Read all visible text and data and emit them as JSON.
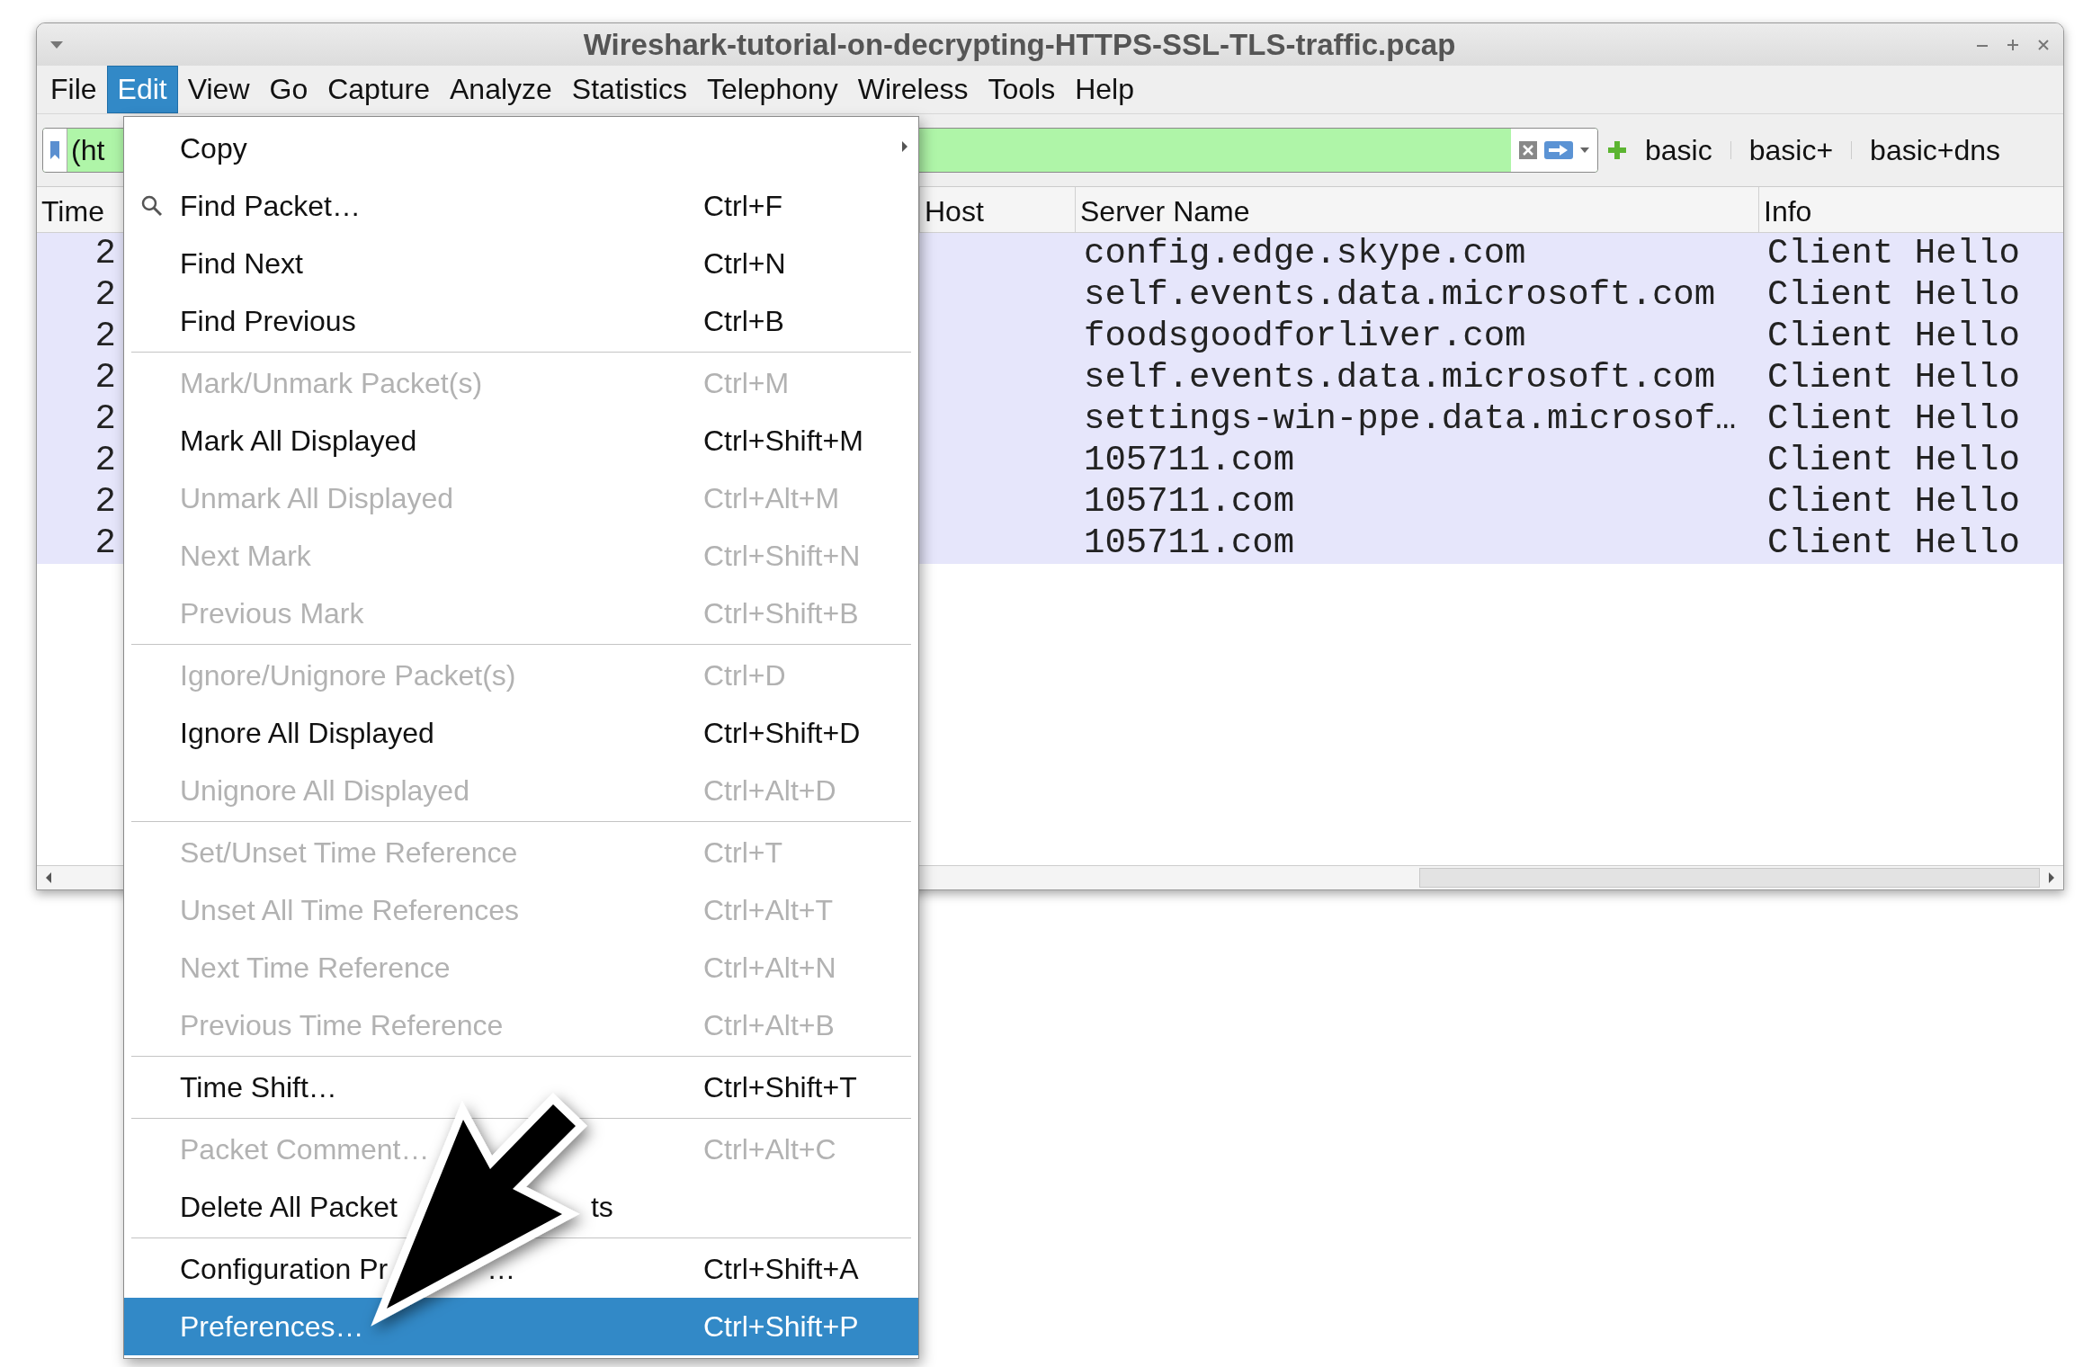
{
  "window": {
    "title": "Wireshark-tutorial-on-decrypting-HTTPS-SSL-TLS-traffic.pcap"
  },
  "menu_bar": [
    {
      "label": "File",
      "selected": false
    },
    {
      "label": "Edit",
      "selected": true
    },
    {
      "label": "View",
      "selected": false
    },
    {
      "label": "Go",
      "selected": false
    },
    {
      "label": "Capture",
      "selected": false
    },
    {
      "label": "Analyze",
      "selected": false
    },
    {
      "label": "Statistics",
      "selected": false
    },
    {
      "label": "Telephony",
      "selected": false
    },
    {
      "label": "Wireless",
      "selected": false
    },
    {
      "label": "Tools",
      "selected": false
    },
    {
      "label": "Help",
      "selected": false
    }
  ],
  "filter_toolbar": {
    "filter": {
      "value": "(ht"
    },
    "buttons": [
      "basic",
      "basic+",
      "basic+dns"
    ]
  },
  "packet_list": {
    "columns": [
      "Time",
      "Host",
      "Server Name",
      "Info"
    ],
    "rows": [
      {
        "time": "2",
        "server_name": "config.edge.skype.com",
        "info": "Client Hello"
      },
      {
        "time": "2",
        "server_name": "self.events.data.microsoft.com",
        "info": "Client Hello"
      },
      {
        "time": "2",
        "server_name": "foodsgoodforliver.com",
        "info": "Client Hello"
      },
      {
        "time": "2",
        "server_name": "self.events.data.microsoft.com",
        "info": "Client Hello"
      },
      {
        "time": "2",
        "server_name": "settings-win-ppe.data.microsof…",
        "info": "Client Hello"
      },
      {
        "time": "2",
        "server_name": "105711.com",
        "info": "Client Hello"
      },
      {
        "time": "2",
        "server_name": "105711.com",
        "info": "Client Hello"
      },
      {
        "time": "2",
        "server_name": "105711.com",
        "info": "Client Hello"
      }
    ]
  },
  "edit_menu": {
    "items": [
      {
        "kind": "submenu",
        "label": "Copy",
        "disabled": false,
        "selected": false
      },
      {
        "kind": "search",
        "label": "Find Packet…",
        "shortcut": "Ctrl+F",
        "disabled": false,
        "selected": false
      },
      {
        "kind": "item",
        "label": "Find Next",
        "shortcut": "Ctrl+N",
        "disabled": false,
        "selected": false
      },
      {
        "kind": "item",
        "label": "Find Previous",
        "shortcut": "Ctrl+B",
        "disabled": false,
        "selected": false
      },
      {
        "kind": "separator"
      },
      {
        "kind": "item",
        "label": "Mark/Unmark Packet(s)",
        "shortcut": "Ctrl+M",
        "disabled": true,
        "selected": false
      },
      {
        "kind": "item",
        "label": "Mark All Displayed",
        "shortcut": "Ctrl+Shift+M",
        "disabled": false,
        "selected": false
      },
      {
        "kind": "item",
        "label": "Unmark All Displayed",
        "shortcut": "Ctrl+Alt+M",
        "disabled": true,
        "selected": false
      },
      {
        "kind": "item",
        "label": "Next Mark",
        "shortcut": "Ctrl+Shift+N",
        "disabled": true,
        "selected": false
      },
      {
        "kind": "item",
        "label": "Previous Mark",
        "shortcut": "Ctrl+Shift+B",
        "disabled": true,
        "selected": false
      },
      {
        "kind": "separator"
      },
      {
        "kind": "item",
        "label": "Ignore/Unignore Packet(s)",
        "shortcut": "Ctrl+D",
        "disabled": true,
        "selected": false
      },
      {
        "kind": "item",
        "label": "Ignore All Displayed",
        "shortcut": "Ctrl+Shift+D",
        "disabled": false,
        "selected": false
      },
      {
        "kind": "item",
        "label": "Unignore All Displayed",
        "shortcut": "Ctrl+Alt+D",
        "disabled": true,
        "selected": false
      },
      {
        "kind": "separator"
      },
      {
        "kind": "item",
        "label": "Set/Unset Time Reference",
        "shortcut": "Ctrl+T",
        "disabled": true,
        "selected": false
      },
      {
        "kind": "item",
        "label": "Unset All Time References",
        "shortcut": "Ctrl+Alt+T",
        "disabled": true,
        "selected": false
      },
      {
        "kind": "item",
        "label": "Next Time Reference",
        "shortcut": "Ctrl+Alt+N",
        "disabled": true,
        "selected": false
      },
      {
        "kind": "item",
        "label": "Previous Time Reference",
        "shortcut": "Ctrl+Alt+B",
        "disabled": true,
        "selected": false
      },
      {
        "kind": "separator"
      },
      {
        "kind": "item",
        "label": "Time Shift…",
        "shortcut": "Ctrl+Shift+T",
        "disabled": false,
        "selected": false
      },
      {
        "kind": "separator"
      },
      {
        "kind": "item",
        "label": "Packet Comment…",
        "shortcut": "Ctrl+Alt+C",
        "disabled": true,
        "selected": false
      },
      {
        "kind": "item",
        "label": "Delete All Packet",
        "label_end": "ts",
        "disabled": false,
        "selected": false
      },
      {
        "kind": "separator"
      },
      {
        "kind": "item",
        "label": "Configuration Pr",
        "label_end": "…",
        "shortcut": "Ctrl+Shift+A",
        "disabled": false,
        "selected": false
      },
      {
        "kind": "item",
        "label": "Preferences…",
        "shortcut": "Ctrl+Shift+P",
        "disabled": false,
        "selected": true
      }
    ]
  }
}
